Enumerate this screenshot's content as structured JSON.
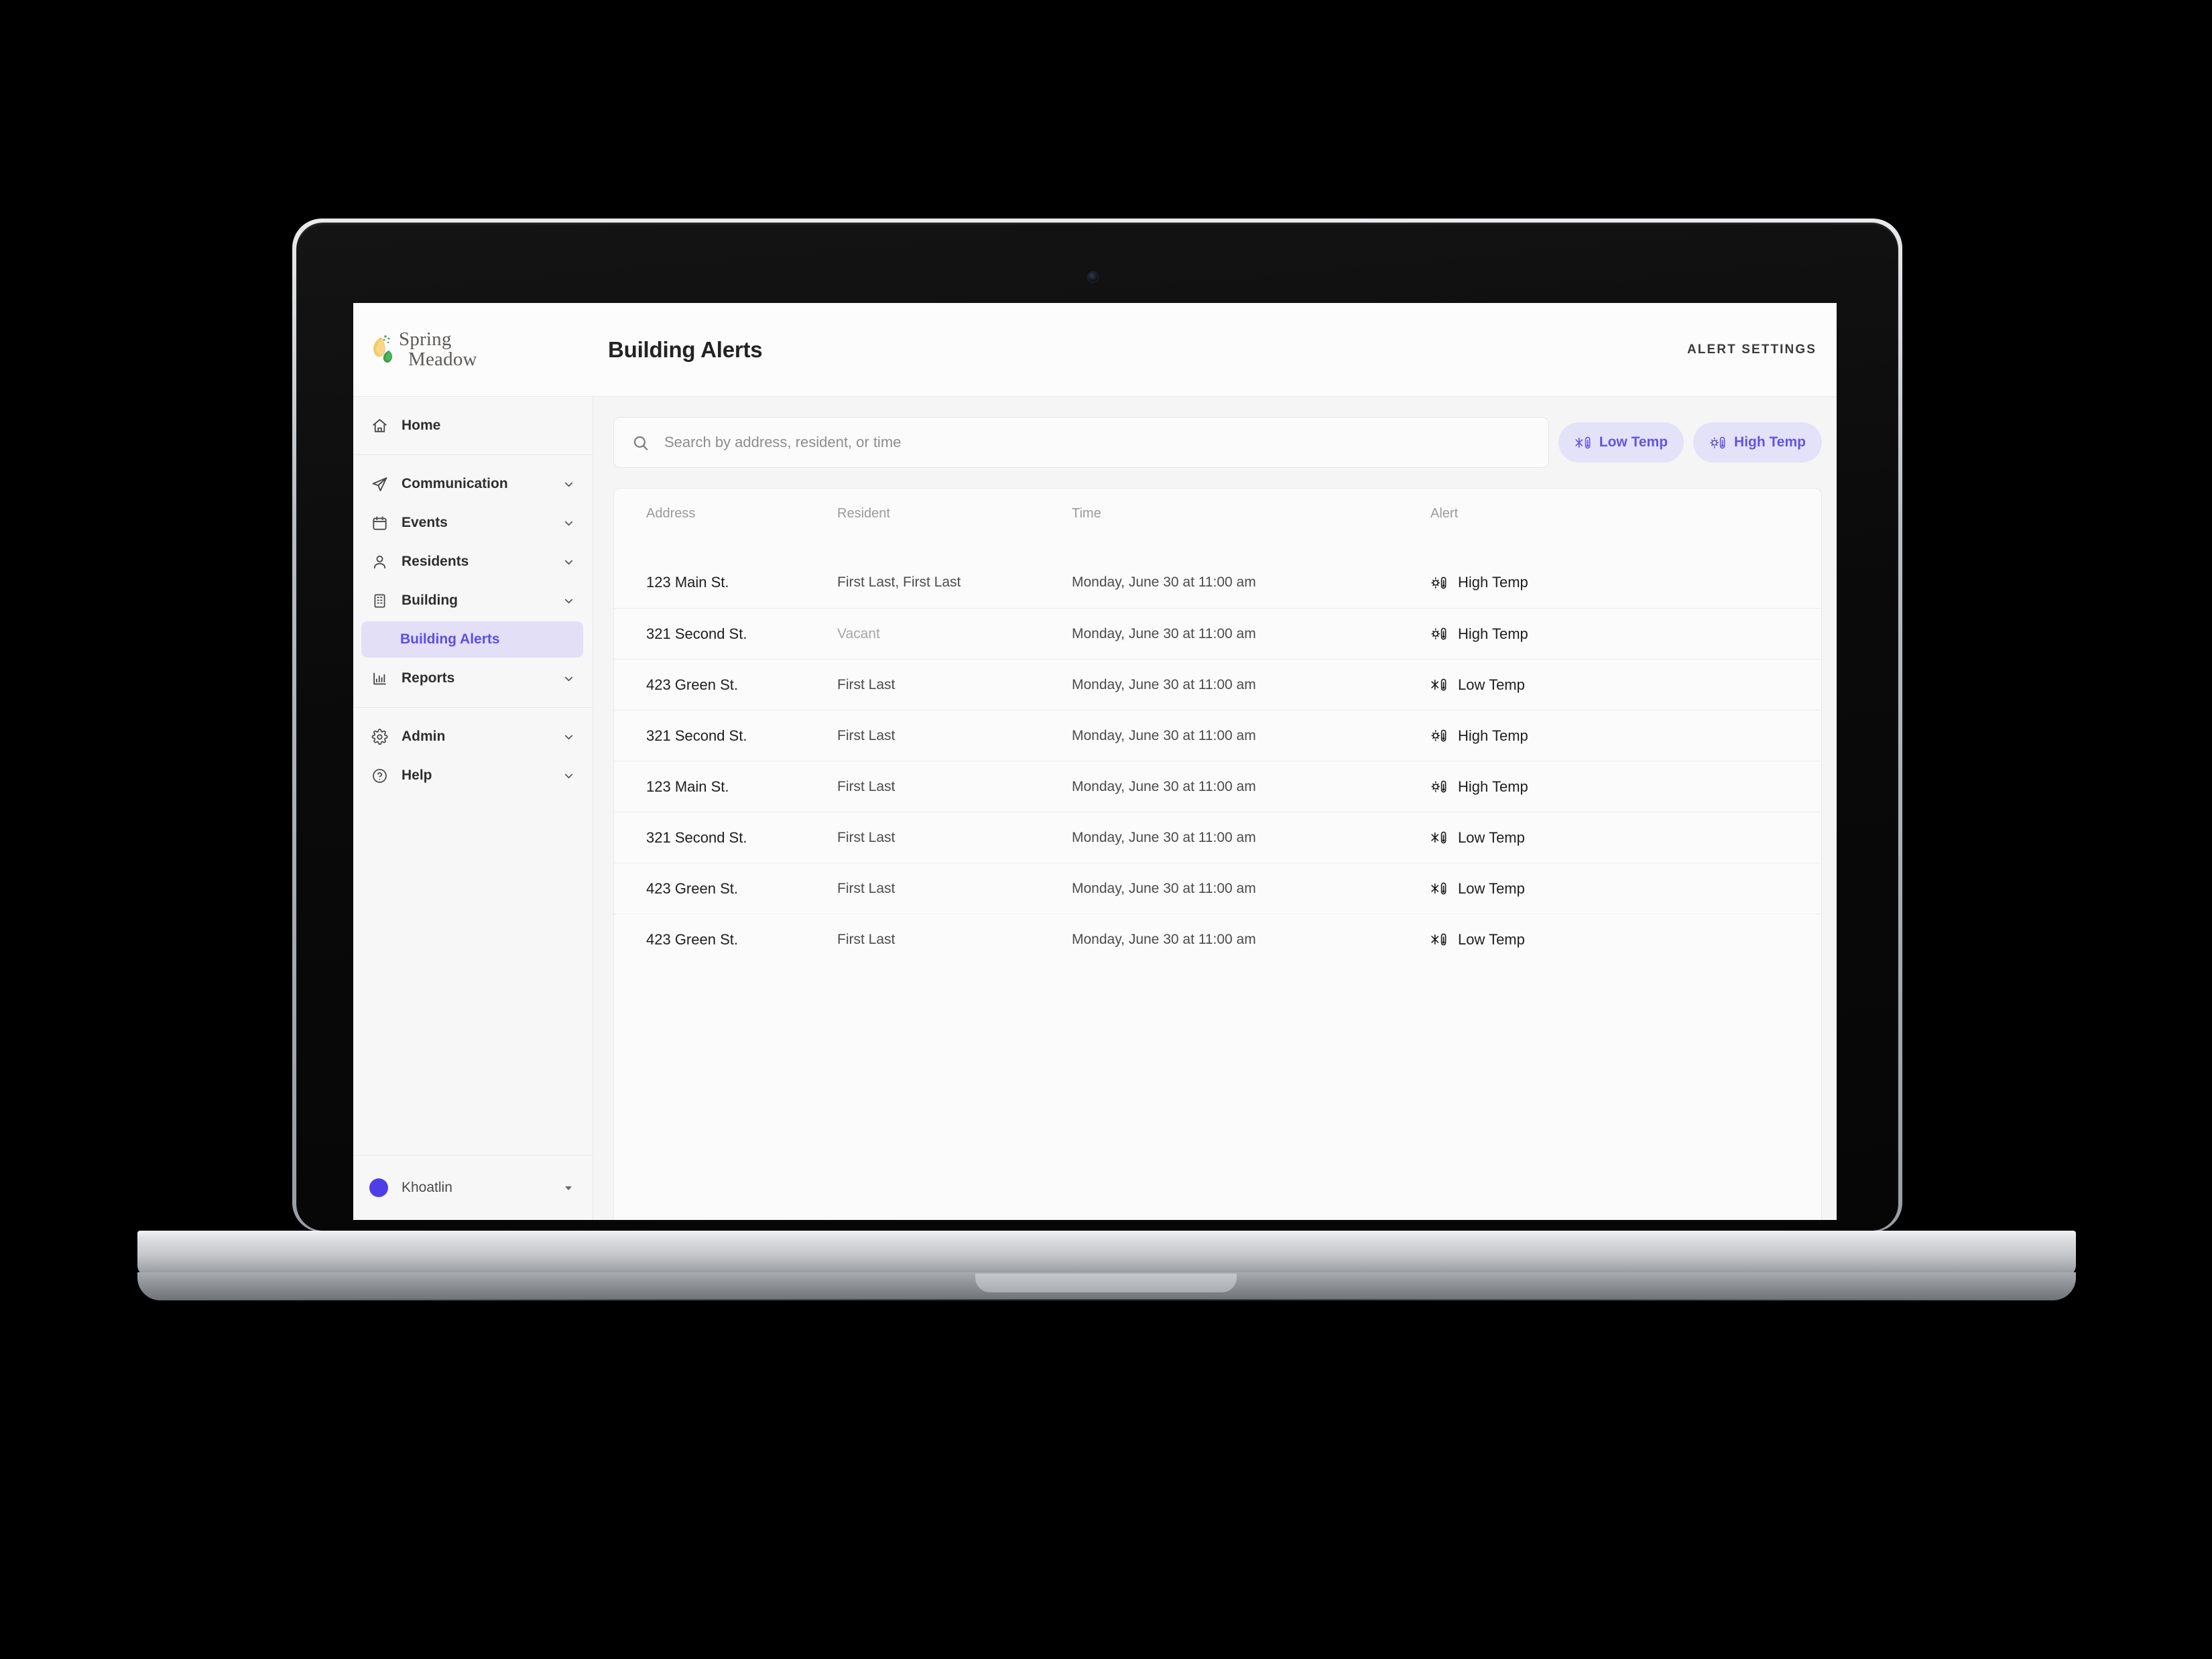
{
  "brand": {
    "line1": "Spring",
    "line2": "Meadow",
    "logo_icon": "leaf-logo-icon",
    "colors": {
      "gold_leaf": "#f0c264",
      "green_leaf": "#3d9e4a"
    }
  },
  "header": {
    "title": "Building Alerts",
    "alert_settings_label": "ALERT SETTINGS"
  },
  "sidebar": {
    "primary": [
      {
        "label": "Home",
        "icon": "home-icon",
        "expandable": false
      }
    ],
    "main": [
      {
        "label": "Communication",
        "icon": "paper-plane-icon",
        "expandable": true
      },
      {
        "label": "Events",
        "icon": "calendar-icon",
        "expandable": true
      },
      {
        "label": "Residents",
        "icon": "person-icon",
        "expandable": true
      },
      {
        "label": "Building",
        "icon": "building-icon",
        "expandable": true
      },
      {
        "label": "Reports",
        "icon": "bar-chart-icon",
        "expandable": true
      }
    ],
    "building_subitems": [
      {
        "label": "Building Alerts",
        "active": true
      }
    ],
    "secondary": [
      {
        "label": "Admin",
        "icon": "gear-icon",
        "expandable": true
      },
      {
        "label": "Help",
        "icon": "question-circle-icon",
        "expandable": true
      }
    ],
    "user": {
      "name": "Khoatlin",
      "avatar_color": "#4f3ee8",
      "caret_icon": "caret-down-icon"
    },
    "active_color": "#5b4fe3",
    "active_bg": "#e2dff6"
  },
  "search": {
    "placeholder": "Search by address, resident, or time",
    "value": "",
    "icon": "search-icon"
  },
  "filters": [
    {
      "label": "Low Temp",
      "icon": "snowflake-thermometer-icon",
      "color": "#6255e0",
      "bg": "#e4e2f8"
    },
    {
      "label": "High Temp",
      "icon": "sun-thermometer-icon",
      "color": "#6255e0",
      "bg": "#e4e2f8"
    }
  ],
  "table": {
    "columns": [
      "Address",
      "Resident",
      "Time",
      "Alert"
    ],
    "rows": [
      {
        "address": "123 Main St.",
        "resident": "First Last, First Last",
        "vacant": false,
        "time": "Monday, June 30 at 11:00 am",
        "alert": "High Temp",
        "alert_icon": "sun-thermometer-icon"
      },
      {
        "address": "321 Second St.",
        "resident": "Vacant",
        "vacant": true,
        "time": "Monday, June 30 at 11:00 am",
        "alert": "High Temp",
        "alert_icon": "sun-thermometer-icon"
      },
      {
        "address": "423 Green St.",
        "resident": "First Last",
        "vacant": false,
        "time": "Monday, June 30 at 11:00 am",
        "alert": "Low Temp",
        "alert_icon": "snowflake-thermometer-icon"
      },
      {
        "address": "321 Second St.",
        "resident": "First Last",
        "vacant": false,
        "time": "Monday, June 30 at 11:00 am",
        "alert": "High Temp",
        "alert_icon": "sun-thermometer-icon"
      },
      {
        "address": "123 Main St.",
        "resident": "First Last",
        "vacant": false,
        "time": "Monday, June 30 at 11:00 am",
        "alert": "High Temp",
        "alert_icon": "sun-thermometer-icon"
      },
      {
        "address": "321 Second St.",
        "resident": "First Last",
        "vacant": false,
        "time": "Monday, June 30 at 11:00 am",
        "alert": "Low Temp",
        "alert_icon": "snowflake-thermometer-icon"
      },
      {
        "address": "423 Green St.",
        "resident": "First Last",
        "vacant": false,
        "time": "Monday, June 30 at 11:00 am",
        "alert": "Low Temp",
        "alert_icon": "snowflake-thermometer-icon"
      },
      {
        "address": "423 Green St.",
        "resident": "First Last",
        "vacant": false,
        "time": "Monday, June 30 at 11:00 am",
        "alert": "Low Temp",
        "alert_icon": "snowflake-thermometer-icon"
      }
    ]
  }
}
